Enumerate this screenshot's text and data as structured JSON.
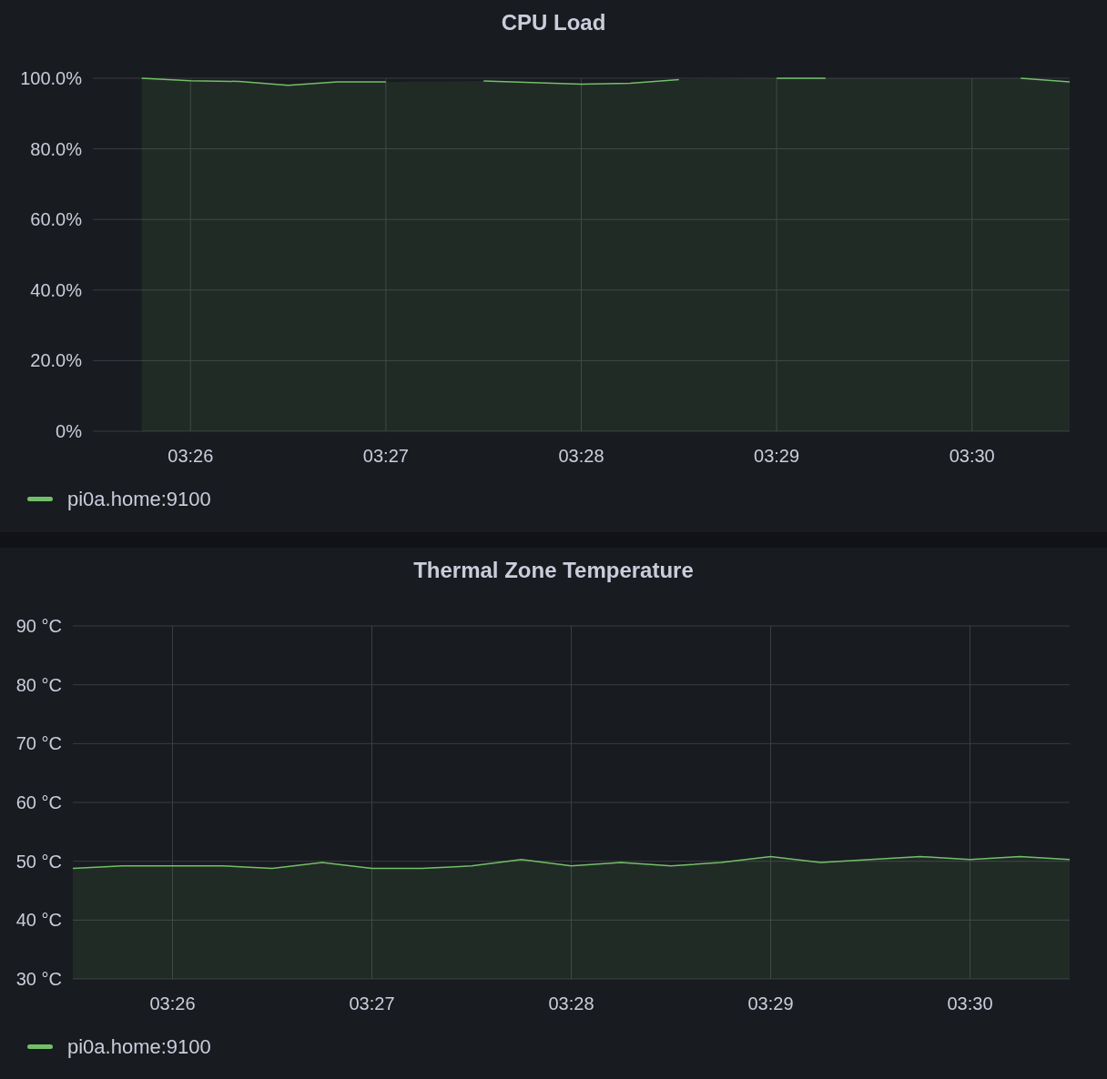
{
  "panels": [
    {
      "title": "CPU Load",
      "chart_data": {
        "type": "area",
        "categories": [
          null,
          null,
          "03:26",
          null,
          null,
          null,
          "03:27",
          null,
          null,
          null,
          "03:28",
          null,
          null,
          null,
          "03:29",
          null,
          null,
          null,
          "03:30",
          null,
          null
        ],
        "series": [
          {
            "name": "pi0a.home:9100",
            "color": "#73bf69",
            "values": [
              null,
              100,
              99.3,
              99.1,
              98,
              99,
              99,
              null,
              99.2,
              98.8,
              98.3,
              98.6,
              99.6,
              null,
              100,
              100,
              null,
              null,
              null,
              100,
              99
            ]
          }
        ],
        "ylim": [
          0,
          100
        ],
        "grid": true,
        "yticks": [
          {
            "value": 0,
            "label": "0%"
          },
          {
            "value": 20,
            "label": "20.0%"
          },
          {
            "value": 40,
            "label": "40.0%"
          },
          {
            "value": 60,
            "label": "60.0%"
          },
          {
            "value": 80,
            "label": "80.0%"
          },
          {
            "value": 100,
            "label": "100.0%"
          }
        ]
      }
    },
    {
      "title": "Thermal Zone Temperature",
      "chart_data": {
        "type": "area",
        "categories": [
          null,
          null,
          "03:26",
          null,
          null,
          null,
          "03:27",
          null,
          null,
          null,
          "03:28",
          null,
          null,
          null,
          "03:29",
          null,
          null,
          null,
          "03:30",
          null,
          null
        ],
        "series": [
          {
            "name": "pi0a.home:9100",
            "color": "#73bf69",
            "values": [
              48.8,
              49.2,
              49.2,
              49.2,
              48.8,
              49.8,
              48.8,
              48.8,
              49.2,
              50.3,
              49.2,
              49.8,
              49.2,
              49.8,
              50.8,
              49.8,
              50.3,
              50.8,
              50.3,
              50.8,
              50.3
            ]
          }
        ],
        "ylim": [
          30,
          90
        ],
        "grid": true,
        "yticks": [
          {
            "value": 30,
            "label": "30 °C"
          },
          {
            "value": 40,
            "label": "40 °C"
          },
          {
            "value": 50,
            "label": "50 °C"
          },
          {
            "value": 60,
            "label": "60 °C"
          },
          {
            "value": 70,
            "label": "70 °C"
          },
          {
            "value": 80,
            "label": "80 °C"
          },
          {
            "value": 90,
            "label": "90 °C"
          }
        ]
      }
    }
  ]
}
